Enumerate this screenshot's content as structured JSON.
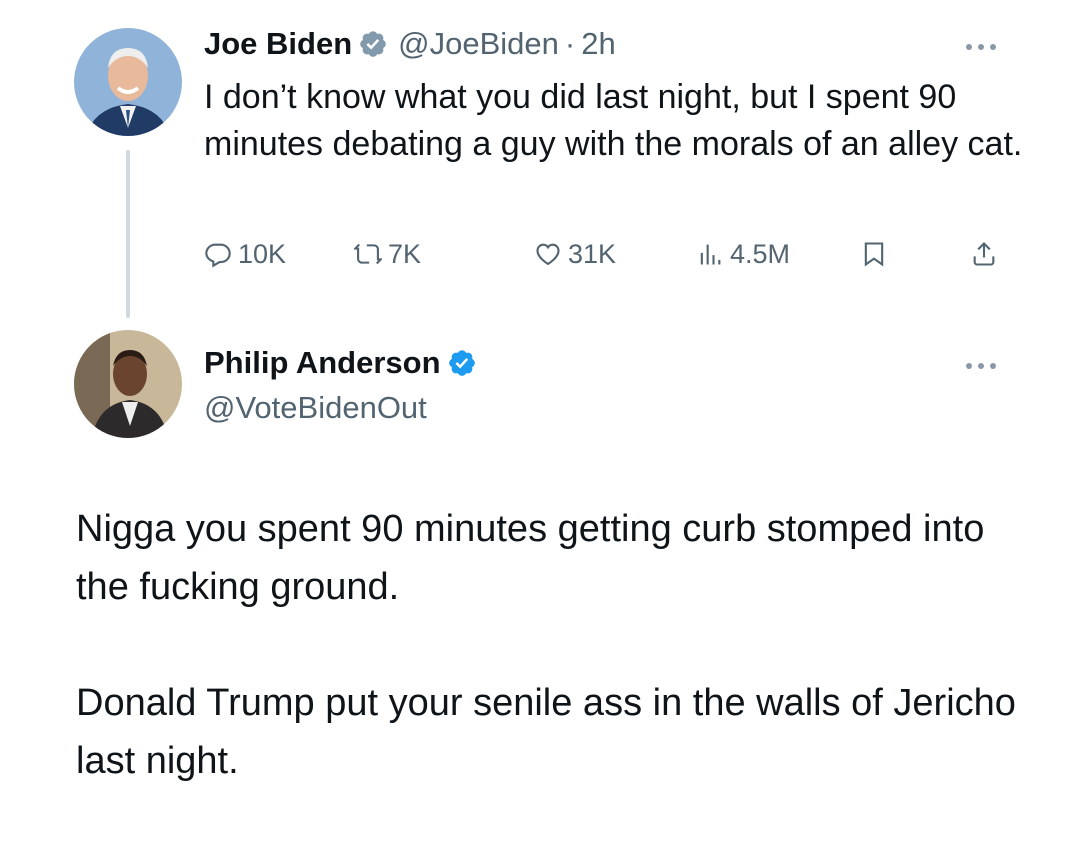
{
  "tweet": {
    "author_name": "Joe Biden",
    "handle": "@JoeBiden",
    "separator": "·",
    "time": "2h",
    "text": "I don’t know what you did last night, but I spent 90 minutes debating a guy with the morals of an alley cat.",
    "stats": {
      "replies": "10K",
      "reposts": "7K",
      "likes": "31K",
      "views": "4.5M"
    },
    "icons": [
      "reply-icon",
      "repost-icon",
      "like-icon",
      "views-icon",
      "bookmark-icon",
      "share-icon",
      "verified-icon",
      "more-icon"
    ]
  },
  "reply": {
    "author_name": "Philip Anderson",
    "handle": "@VoteBidenOut",
    "paragraph_1": "Nigga you spent 90 minutes getting curb stomped into the fucking ground.",
    "paragraph_2": "Donald Trump put your senile ass in the walls of Jericho last night."
  },
  "colors": {
    "text": "#0f1419",
    "secondary": "#536471",
    "verified_blue": "#1d9bf0",
    "verified_gray": "#829aab",
    "thread_line": "#cfd9de"
  }
}
